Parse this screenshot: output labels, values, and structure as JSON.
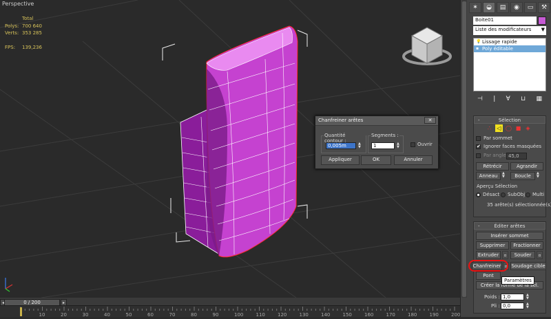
{
  "viewport": {
    "label": "Perspective",
    "stats": {
      "header": "Total",
      "polys_label": "Polys:",
      "polys_value": "700 640",
      "verts_label": "Verts:",
      "verts_value": "353 285",
      "fps_label": "FPS:",
      "fps_value": "139,236"
    }
  },
  "panel": {
    "tabs": [
      "✶",
      "◒",
      "▤",
      "◉",
      "▭",
      "⚒"
    ],
    "object_name": "Boite01",
    "object_color": "#c65ad4",
    "modifier_list": "Liste des modificateurs",
    "stack": [
      {
        "label": "Lissage rapide",
        "selected": false
      },
      {
        "label": "Poly éditable",
        "selected": true
      }
    ],
    "selection": {
      "title": "Sélection",
      "par_sommet": "Par sommet",
      "ignorer": "Ignorer faces masquées",
      "par_angle": "Par angle :",
      "par_angle_value": "45,0",
      "retrecir": "Rétrécir",
      "agrandir": "Agrandir",
      "anneau": "Anneau",
      "boucle": "Boucle",
      "apercu": "Aperçu Sélection",
      "desact": "Désact",
      "subobj": "SubObj",
      "multi": "Multi",
      "status": "35 arête(s) sélectionnée(s)"
    },
    "editer": {
      "title": "Éditer arêtes",
      "inserer": "Insérer sommet",
      "supprimer": "Supprimer",
      "fractionner": "Fractionner",
      "extruder": "Extruder",
      "souder": "Souder",
      "chanfreiner": "Chanfreiner",
      "soudage_cible": "Soudage cible",
      "pont": "Pont",
      "creer_forme": "Créer la forme de la sél.",
      "poids_label": "Poids :",
      "poids_value": "1,0",
      "pli_label": "Pli :",
      "pli_value": "0,0"
    },
    "tooltip": "Paramètres"
  },
  "dialog": {
    "title": "Chanfreiner arêtes",
    "close": "✕",
    "quantite_label": "Quantité contour :",
    "quantite_value": "0,005m",
    "segments_label": "Segments :",
    "segments_value": "1",
    "ouvrir": "Ouvrir",
    "appliquer": "Appliquer",
    "ok": "OK",
    "annuler": "Annuler"
  },
  "timeline": {
    "frame": "0 / 200",
    "ticks": [
      "10",
      "20",
      "30",
      "40",
      "50",
      "60",
      "70",
      "80",
      "90",
      "100",
      "110",
      "120",
      "130",
      "140",
      "150",
      "160",
      "170",
      "180",
      "190",
      "200"
    ]
  }
}
